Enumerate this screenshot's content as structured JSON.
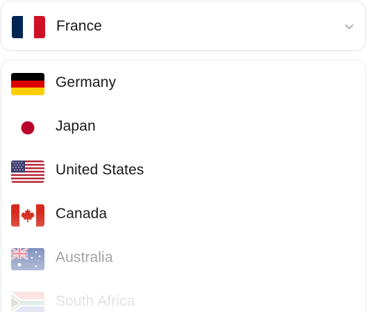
{
  "selected": {
    "label": "France",
    "flag_icon": "france-flag-icon"
  },
  "options": [
    {
      "label": "Germany",
      "flag_icon": "germany-flag-icon"
    },
    {
      "label": "Japan",
      "flag_icon": "japan-flag-icon"
    },
    {
      "label": "United States",
      "flag_icon": "united-states-flag-icon"
    },
    {
      "label": "Canada",
      "flag_icon": "canada-flag-icon"
    },
    {
      "label": "Australia",
      "flag_icon": "australia-flag-icon"
    },
    {
      "label": "South Africa",
      "flag_icon": "south-africa-flag-icon"
    }
  ],
  "colors": {
    "text": "#18181b",
    "border": "#e6e6e9",
    "chevron": "#a1a1aa"
  }
}
